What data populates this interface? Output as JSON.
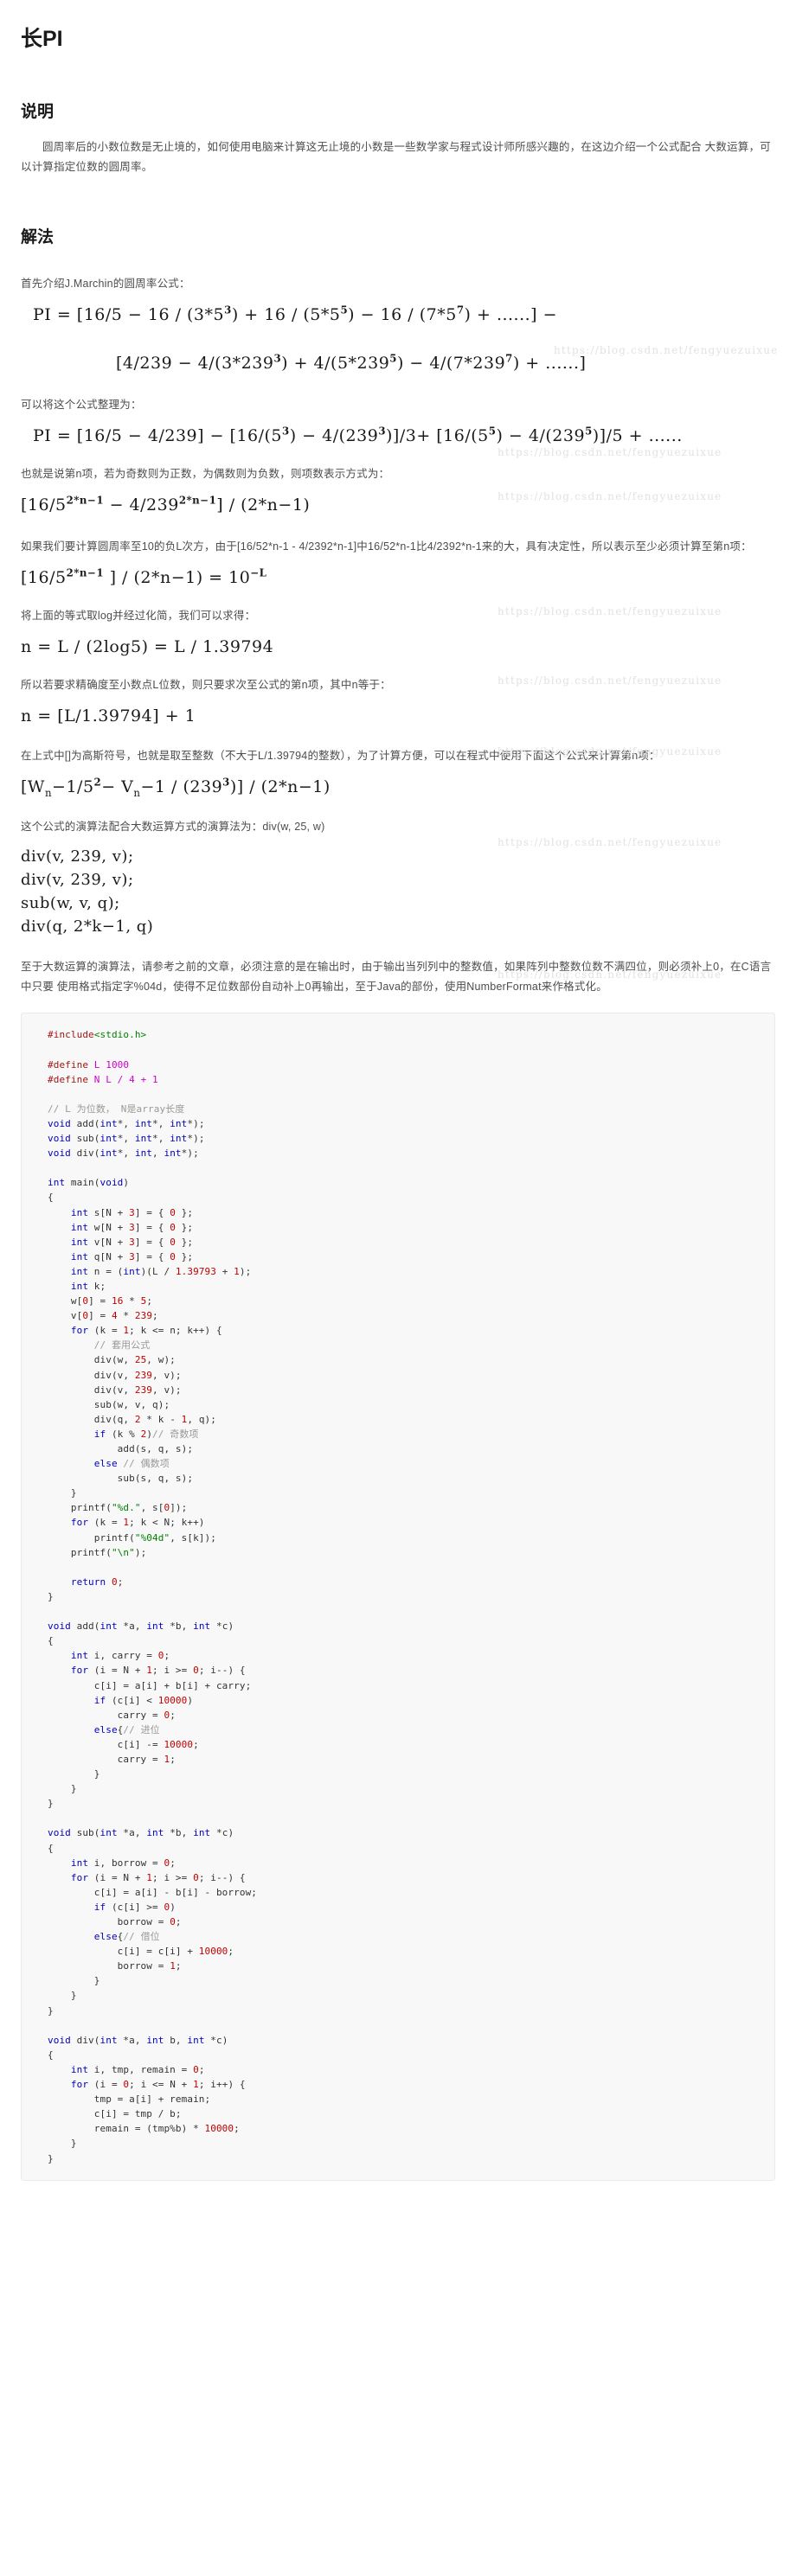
{
  "doc": {
    "title": "长PI",
    "watermark": "https://blog.csdn.net/fengyuezuixue"
  },
  "sections": {
    "desc": {
      "heading": "说明",
      "para": "圆周率后的小数位数是无止境的，如何使用电脑来计算这无止境的小数是一些数学家与程式设计师所感兴趣的，在这边介绍一个公式配合 大数运算，可以计算指定位数的圆周率。"
    },
    "method": {
      "heading": "解法",
      "lead": "首先介绍J.Marchin的圆周率公式："
    }
  },
  "formulas": {
    "marchin_line1": "PI = [16/5 − 16 / (3*5³) + 16 / (5*5⁵) − 16 / (7*5⁷) + ......] −",
    "marchin_line2": "[4/239 − 4/(3*239³) + 4/(5*239⁵) − 4/(7*239⁷) + ......]",
    "rearrange_lead": "可以将这个公式整理为：",
    "rearranged": "PI = [16/5 − 4/239] − [16/(5³) − 4/(239³)]/3+ [16/(5⁵) − 4/(239⁵)]/5 + ......",
    "sign_lead": "也就是说第n项，若为奇数则为正数，为偶数则为负数，则项数表示方式为：",
    "term": "[16/5^(2*n−1) − 4/239^(2*n−1)] / (2*n−1)",
    "precision_para": "如果我们要计算圆周率至10的负L次方，由于[16/52*n-1 - 4/2392*n-1]中16/52*n-1比4/2392*n-1来的大，具有决定性，所以表示至少必须计算至第n项：",
    "precision_eq": "[16/5^(2*n−1) ] / (2*n−1) = 10^(−L)",
    "log_lead": "将上面的等式取log并经过化简，我们可以求得：",
    "log_eq": "n = L / (2log5) = L / 1.39794",
    "ceil_lead": "所以若要求精确度至小数点L位数，则只要求次至公式的第n项，其中n等于：",
    "ceil_eq": "n = [L/1.39794] + 1",
    "int_lead": "在上式中[]为高斯符号，也就是取至整数（不大于L/1.39794的整数），为了计算方便，可以在程式中使用下面这个公式来计算第n项：",
    "int_eq": "[Wₙ−1/5² − Vₙ−1 / (239³)] / (2*n−1)"
  },
  "calls": {
    "lead": "这个公式的演算法配合大数运算方式的演算法为：div(w, 25, w)",
    "lines": [
      "div(v, 239, v);",
      "div(v, 239, v);",
      "sub(w, v, q);",
      "div(q, 2*k−1, q)"
    ]
  },
  "notes": {
    "bignum": "至于大数运算的演算法，请参考之前的文章，必须注意的是在输出时，由于输出当列列中的整数值，如果阵列中整数位数不满四位，则必须补上0，在C语言中只要 使用格式指定字%04d，使得不足位数部份自动补上0再输出，至于Java的部份，使用NumberFormat来作格式化。"
  },
  "code": {
    "language": "c",
    "text": "#include<stdio.h>\n\n#define L 1000\n#define N L / 4 + 1\n\n// L 为位数， N是array长度\nvoid add(int*, int*, int*);\nvoid sub(int*, int*, int*);\nvoid div(int*, int, int*);\n\nint main(void)\n{\n    int s[N + 3] = { 0 };\n    int w[N + 3] = { 0 };\n    int v[N + 3] = { 0 };\n    int q[N + 3] = { 0 };\n    int n = (int)(L / 1.39793 + 1);\n    int k;\n    w[0] = 16 * 5;\n    v[0] = 4 * 239;\n    for (k = 1; k <= n; k++) {\n        // 套用公式\n        div(w, 25, w);\n        div(v, 239, v);\n        div(v, 239, v);\n        sub(w, v, q);\n        div(q, 2 * k - 1, q);\n        if (k % 2)// 奇数项\n            add(s, q, s);\n        else // 偶数项\n            sub(s, q, s);\n    }\n    printf(\"%d.\", s[0]);\n    for (k = 1; k < N; k++)\n        printf(\"%04d\", s[k]);\n    printf(\"\\n\");\n\n    return 0;\n}\n\nvoid add(int *a, int *b, int *c)\n{\n    int i, carry = 0;\n    for (i = N + 1; i >= 0; i--) {\n        c[i] = a[i] + b[i] + carry;\n        if (c[i] < 10000)\n            carry = 0;\n        else{// 进位\n            c[i] -= 10000;\n            carry = 1;\n        }\n    }\n}\n\nvoid sub(int *a, int *b, int *c)\n{\n    int i, borrow = 0;\n    for (i = N + 1; i >= 0; i--) {\n        c[i] = a[i] - b[i] - borrow;\n        if (c[i] >= 0)\n            borrow = 0;\n        else{// 借位\n            c[i] = c[i] + 10000;\n            borrow = 1;\n        }\n    }\n}\n\nvoid div(int *a, int b, int *c)\n{\n    int i, tmp, remain = 0;\n    for (i = 0; i <= N + 1; i++) {\n        tmp = a[i] + remain;\n        c[i] = tmp / b;\n        remain = (tmp%b) * 10000;\n    }\n}"
  }
}
